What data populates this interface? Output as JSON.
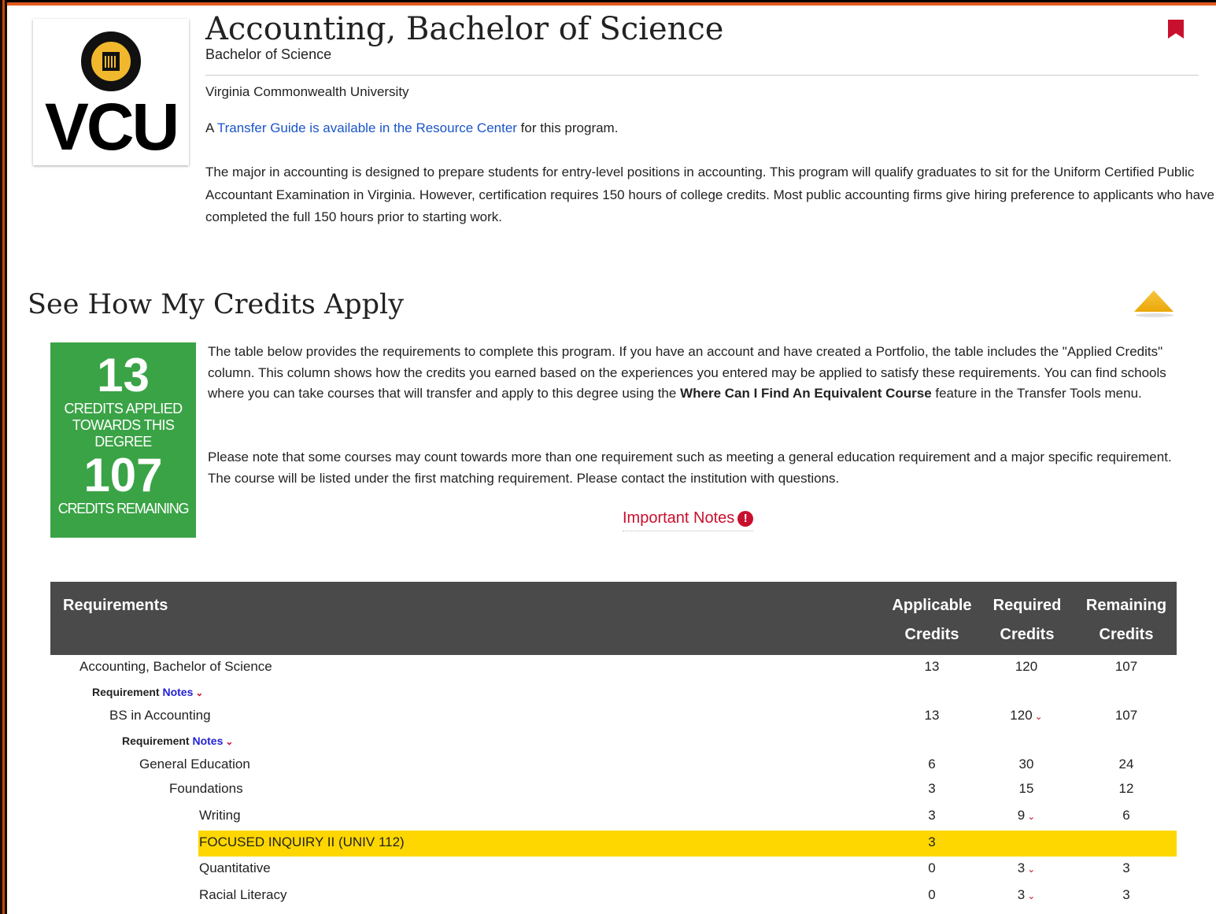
{
  "program": {
    "title": "Accounting, Bachelor of Science",
    "degree": "Bachelor of Science",
    "institution": "Virginia Commonwealth University",
    "logo_text": "VCU",
    "guide_prefix": "A ",
    "guide_link": "Transfer Guide is available in the Resource Center",
    "guide_suffix": " for this program.",
    "description": "The major in accounting is designed to prepare students for entry-level positions in accounting. This program will qualify graduates to sit for the Uniform Certified Public Accountant Examination in Virginia. However, certification requires 150 hours of college credits. Most public accounting firms give hiring preference to applicants who have completed the full 150 hours prior to starting work."
  },
  "credits_section": {
    "title": "See How My Credits Apply",
    "applied": "13",
    "applied_label": "CREDITS APPLIED TOWARDS THIS DEGREE",
    "remaining": "107",
    "remaining_label": "CREDITS REMAINING",
    "info1_a": "The table below provides the requirements to complete this program. If you have an account and have created a Portfolio, the table includes the \"Applied Credits\" column. This column shows how the credits you earned based on the experiences you entered may be applied to satisfy these requirements. You can find schools where you can take courses that will transfer and apply to this degree using the ",
    "info1_bold": "Where Can I Find An Equivalent Course",
    "info1_b": " feature in the Transfer Tools menu.",
    "info2": "Please note that some courses may count towards more than one requirement such as meeting a general education requirement and a major specific requirement. The course will be listed under the first matching requirement. Please contact the institution with questions.",
    "important_notes": "Important Notes",
    "alert_glyph": "!"
  },
  "table": {
    "headers": {
      "requirements": "Requirements",
      "applicable_1": "Applicable",
      "applicable_2": "Credits",
      "required_1": "Required",
      "required_2": "Credits",
      "remaining_1": "Remaining",
      "remaining_2": "Credits"
    },
    "note_bold": "Requirement",
    "note_link": "Notes",
    "chevron": "⌄",
    "rows": [
      {
        "label": "Accounting, Bachelor of Science",
        "applicable": "13",
        "required": "120",
        "remaining": "107"
      },
      {
        "label": "BS in Accounting",
        "applicable": "13",
        "required": "120",
        "remaining": "107"
      },
      {
        "label": "General Education",
        "applicable": "6",
        "required": "30",
        "remaining": "24"
      },
      {
        "label": "Foundations",
        "applicable": "3",
        "required": "15",
        "remaining": "12"
      },
      {
        "label": "Writing",
        "applicable": "3",
        "required": "9",
        "remaining": "6"
      },
      {
        "label": "FOCUSED INQUIRY II (UNIV 112)",
        "applicable": "3",
        "required": "",
        "remaining": ""
      },
      {
        "label": "Quantitative",
        "applicable": "0",
        "required": "3",
        "remaining": "3"
      },
      {
        "label": "Racial Literacy",
        "applicable": "0",
        "required": "3",
        "remaining": "3"
      }
    ]
  },
  "colors": {
    "accent_red": "#c8102e",
    "credits_green": "#3aa346",
    "highlight_yellow": "#ffd700",
    "header_gray": "#4a4a4a",
    "link_blue": "#1a55c8"
  },
  "icons": [
    "bookmark-icon",
    "collapse-up-icon",
    "alert-icon",
    "chevron-down-icon"
  ]
}
